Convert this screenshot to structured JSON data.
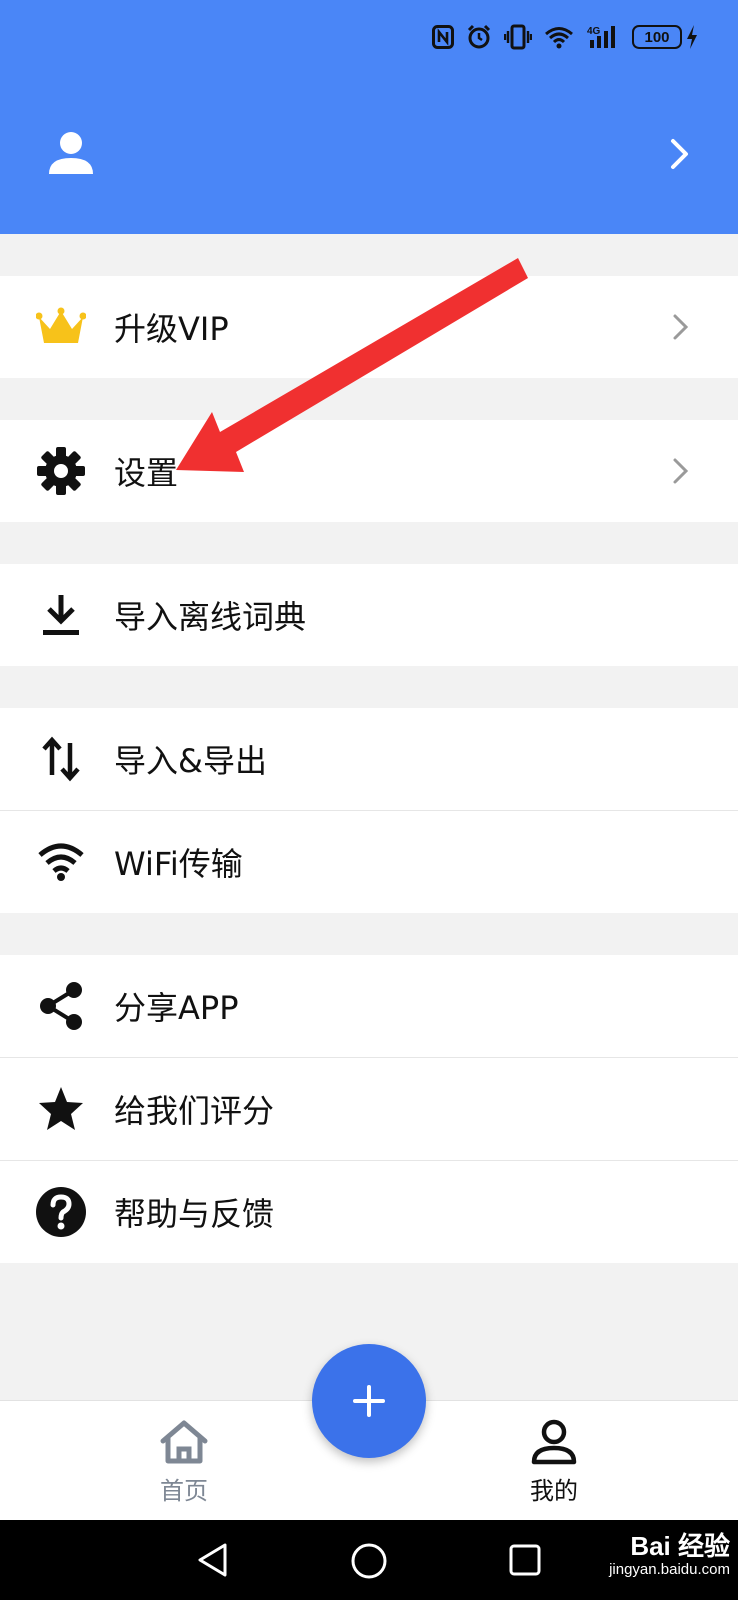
{
  "status_bar": {
    "battery_level": "100",
    "network": "4G",
    "icons": [
      "nfc-icon",
      "alarm-icon",
      "vibrate-icon",
      "wifi-icon",
      "signal-icon",
      "battery-icon",
      "charging-icon"
    ]
  },
  "header": {
    "avatar_icon": "user-icon",
    "background_color": "#4a86f7"
  },
  "menu": {
    "vip": {
      "label": "升级VIP",
      "icon": "crown-icon"
    },
    "settings": {
      "label": "设置",
      "icon": "gear-icon"
    },
    "import_dictionary": {
      "label": "导入离线词典",
      "icon": "download-icon"
    },
    "import_export": {
      "label": "导入&导出",
      "icon": "swap-vertical-icon"
    },
    "wifi_transfer": {
      "label": "WiFi传输",
      "icon": "wifi-icon"
    },
    "share_app": {
      "label": "分享APP",
      "icon": "share-icon"
    },
    "rate_us": {
      "label": "给我们评分",
      "icon": "star-icon"
    },
    "help_feedback": {
      "label": "帮助与反馈",
      "icon": "help-icon"
    }
  },
  "bottom_nav": {
    "home": {
      "label": "首页",
      "icon": "home-icon"
    },
    "mine": {
      "label": "我的",
      "icon": "person-icon"
    },
    "fab": {
      "icon": "plus-icon",
      "color": "#3b72ea"
    }
  },
  "watermark": {
    "brand": "Bai 经验",
    "url": "jingyan.baidu.com"
  },
  "annotation": {
    "arrow_color": "#f03030"
  }
}
